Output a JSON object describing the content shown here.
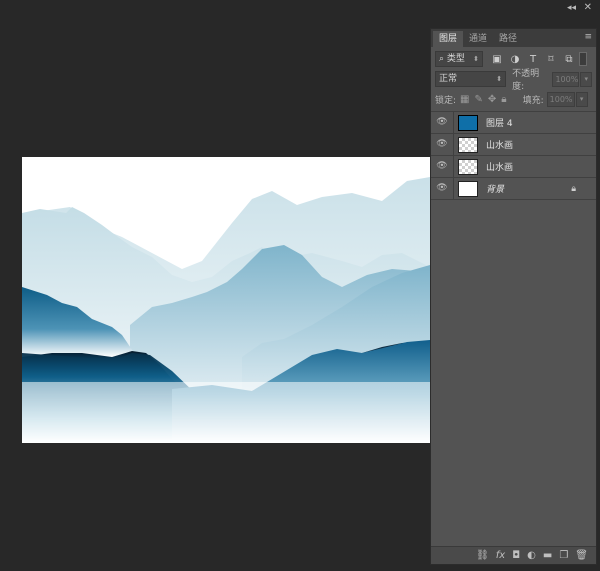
{
  "window": {
    "collapse_glyph": "◂◂",
    "close_glyph": "✕"
  },
  "panel": {
    "tabs": [
      {
        "label": "图层",
        "active": true
      },
      {
        "label": "通道",
        "active": false
      },
      {
        "label": "路径",
        "active": false
      }
    ],
    "menu_glyph": "≡",
    "filter": {
      "search_glyph": "⌕",
      "label": "类型",
      "icons": [
        "image-filter-icon",
        "adjustment-filter-icon",
        "type-filter-icon",
        "shape-filter-icon",
        "smart-object-filter-icon"
      ]
    },
    "blend": {
      "mode": "正常",
      "opacity_label": "不透明度:",
      "opacity_value": "100%"
    },
    "lock": {
      "label": "锁定:",
      "fill_label": "填充:",
      "fill_value": "100%"
    },
    "layers": [
      {
        "name": "图层 4",
        "thumb": "blue",
        "locked": false,
        "italic": false
      },
      {
        "name": "山水画",
        "thumb": "checker",
        "locked": false,
        "italic": false
      },
      {
        "name": "山水画",
        "thumb": "checker",
        "locked": false,
        "italic": false
      },
      {
        "name": "背景",
        "thumb": "white",
        "locked": true,
        "italic": true
      }
    ],
    "footer_icons": [
      "link-icon",
      "fx-icon",
      "mask-icon",
      "adjustment-icon",
      "group-folder-icon",
      "new-layer-icon",
      "trash-icon"
    ]
  },
  "colors": {
    "workspace": "#282828",
    "panel": "#535353",
    "accent": "#0f6fa8"
  }
}
